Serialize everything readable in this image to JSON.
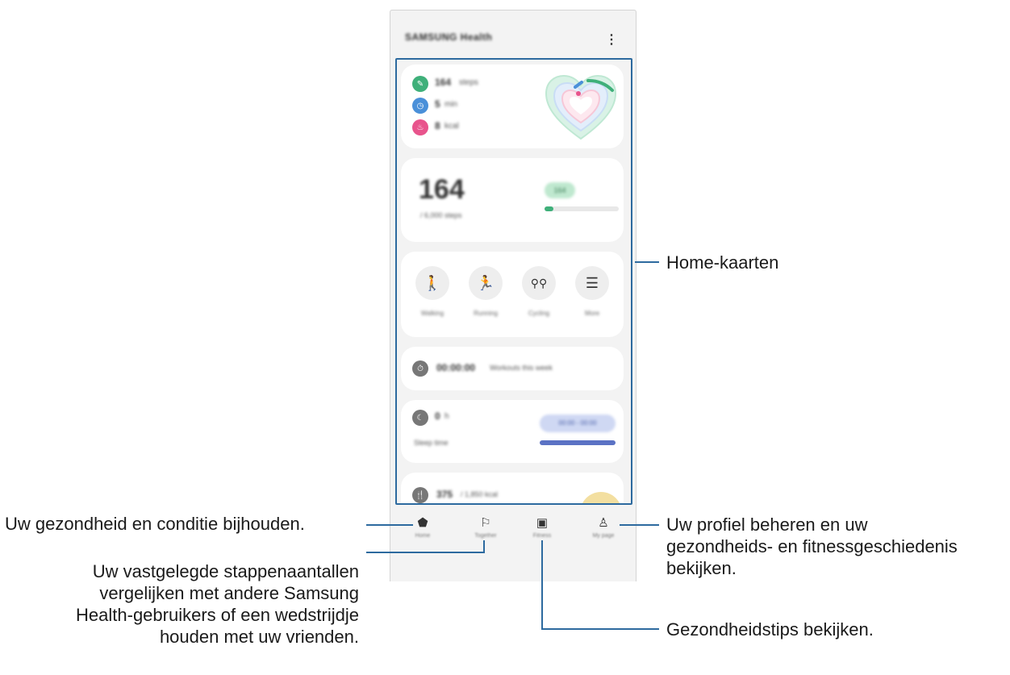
{
  "app": {
    "title": "SAMSUNG Health",
    "more_icon": "more-vert-icon"
  },
  "cards": {
    "activity": {
      "steps": "164",
      "steps_unit": "steps",
      "minutes": "5",
      "minutes_unit": "min",
      "calories": "8",
      "calories_unit": "kcal"
    },
    "steps": {
      "count": "164",
      "goal_text": "/ 6,000 steps",
      "badge": "164",
      "progress": 0.05
    },
    "exercise": {
      "items": [
        {
          "label": "Walking",
          "icon": "walk-icon"
        },
        {
          "label": "Running",
          "icon": "run-icon"
        },
        {
          "label": "Cycling",
          "icon": "bike-icon"
        },
        {
          "label": "More",
          "icon": "list-icon"
        }
      ]
    },
    "timer": {
      "time": "00:00:00",
      "text": "Workouts this week"
    },
    "sleep": {
      "value": "0",
      "unit": "h",
      "label": "Sleep time",
      "badge": "00:00 - 00:00"
    },
    "food": {
      "value": "375",
      "text": "/ 1,850 kcal"
    }
  },
  "nav": [
    {
      "label": "Home",
      "icon": "home-icon"
    },
    {
      "label": "Together",
      "icon": "flag-icon"
    },
    {
      "label": "Fitness",
      "icon": "calendar-play-icon"
    },
    {
      "label": "My page",
      "icon": "person-icon"
    }
  ],
  "callouts": {
    "home_cards": "Home-kaarten",
    "home": "Uw gezondheid en conditie bijhouden.",
    "together_1": "Uw vastgelegde stappenaantallen",
    "together_2": "vergelijken met andere Samsung",
    "together_3": "Health-gebruikers of een wedstrijdje",
    "together_4": "houden met uw vrienden.",
    "profile_1": "Uw profiel beheren en uw",
    "profile_2": "gezondheids- en fitnessgeschiedenis",
    "profile_3": "bekijken.",
    "fitness": "Gezondheidstips bekijken."
  },
  "colors": {
    "frame": "#2d6a9f",
    "green": "#3fb07a",
    "blue": "#4a90d9",
    "pink": "#e8548c",
    "sleep_bar": "#5b72c4"
  }
}
